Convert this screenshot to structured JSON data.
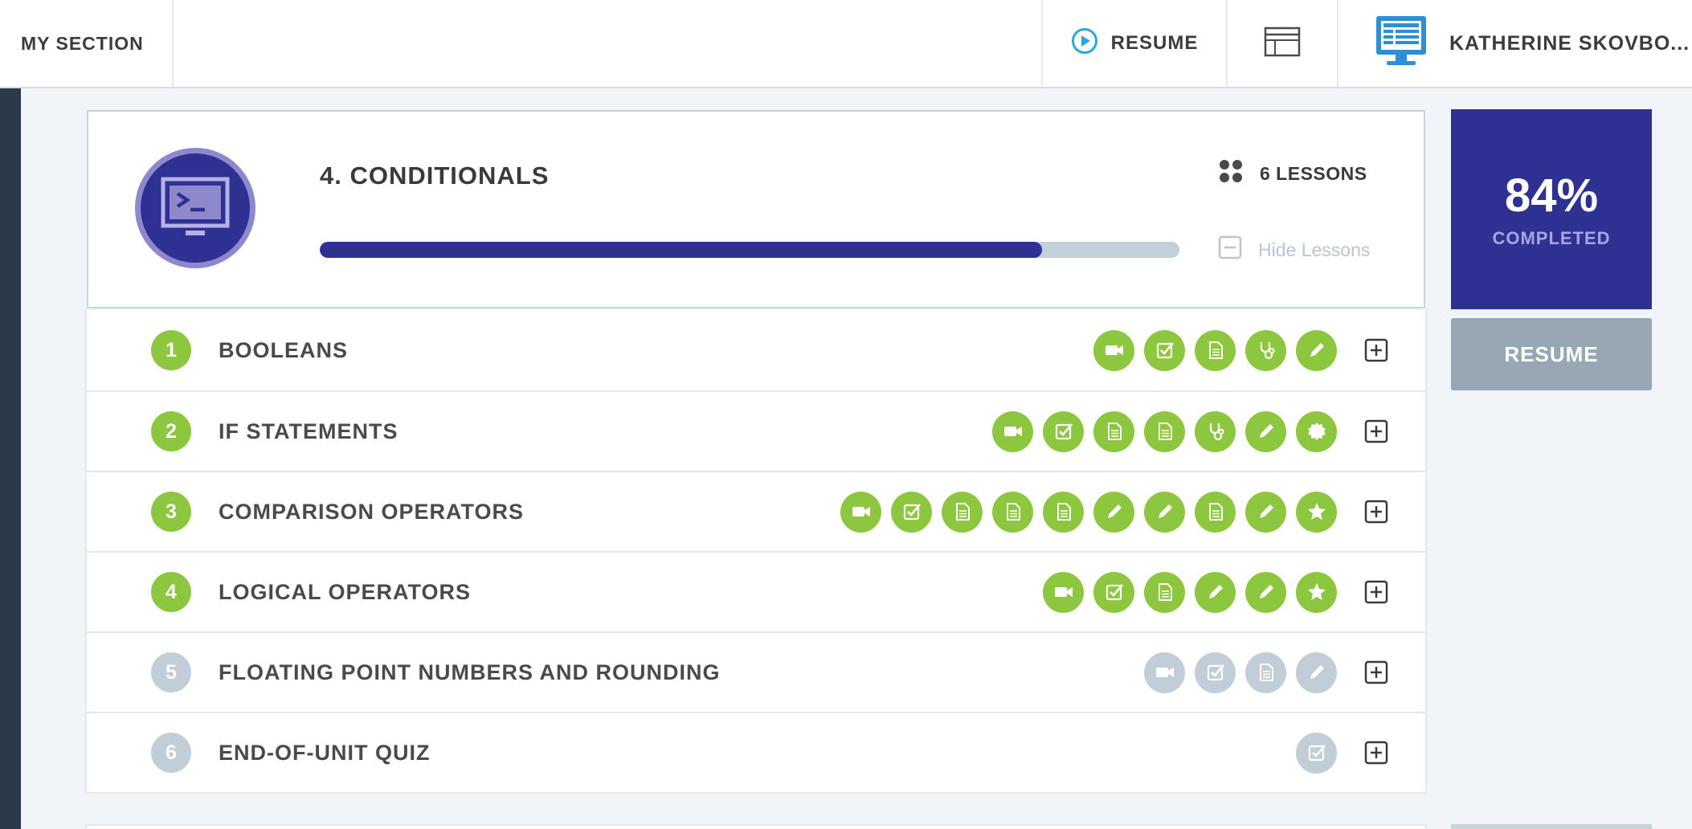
{
  "topbar": {
    "section_label": "MY SECTION",
    "resume_label": "RESUME",
    "user_name": "KATHERINE SKOVBO..."
  },
  "unit": {
    "title": "4. CONDITIONALS",
    "lessons_count": "6 LESSONS",
    "hide_lessons": "Hide Lessons",
    "progress_fraction": 0.84
  },
  "completion": {
    "percent": "84%",
    "label": "COMPLETED",
    "resume_button": "RESUME"
  },
  "colors": {
    "accent": "#2e3192",
    "complete_green": "#8dc63f",
    "pending_gray": "#c2ced7",
    "resume_gray": "#97a7b4"
  },
  "lessons": [
    {
      "number": "1",
      "title": "BOOLEANS",
      "status": "complete",
      "activities": [
        {
          "icon": "video-icon",
          "status": "complete"
        },
        {
          "icon": "checkbox-icon",
          "status": "complete"
        },
        {
          "icon": "document-icon",
          "status": "complete"
        },
        {
          "icon": "stethoscope-icon",
          "status": "complete"
        },
        {
          "icon": "pencil-icon",
          "status": "complete"
        }
      ]
    },
    {
      "number": "2",
      "title": "IF STATEMENTS",
      "status": "complete",
      "activities": [
        {
          "icon": "video-icon",
          "status": "complete"
        },
        {
          "icon": "checkbox-icon",
          "status": "complete"
        },
        {
          "icon": "document-icon",
          "status": "complete"
        },
        {
          "icon": "document-icon",
          "status": "complete"
        },
        {
          "icon": "stethoscope-icon",
          "status": "complete"
        },
        {
          "icon": "pencil-icon",
          "status": "complete"
        },
        {
          "icon": "badge-icon",
          "status": "complete"
        }
      ]
    },
    {
      "number": "3",
      "title": "COMPARISON OPERATORS",
      "status": "complete",
      "activities": [
        {
          "icon": "video-icon",
          "status": "complete"
        },
        {
          "icon": "checkbox-icon",
          "status": "complete"
        },
        {
          "icon": "document-icon",
          "status": "complete"
        },
        {
          "icon": "document-icon",
          "status": "complete"
        },
        {
          "icon": "document-icon",
          "status": "complete"
        },
        {
          "icon": "pencil-icon",
          "status": "complete"
        },
        {
          "icon": "pencil-icon",
          "status": "complete"
        },
        {
          "icon": "document-icon",
          "status": "complete"
        },
        {
          "icon": "pencil-icon",
          "status": "complete"
        },
        {
          "icon": "star-icon",
          "status": "complete"
        }
      ]
    },
    {
      "number": "4",
      "title": "LOGICAL OPERATORS",
      "status": "complete",
      "activities": [
        {
          "icon": "video-icon",
          "status": "complete"
        },
        {
          "icon": "checkbox-icon",
          "status": "complete"
        },
        {
          "icon": "document-icon",
          "status": "complete"
        },
        {
          "icon": "pencil-icon",
          "status": "complete"
        },
        {
          "icon": "pencil-icon",
          "status": "complete"
        },
        {
          "icon": "star-icon",
          "status": "complete"
        }
      ]
    },
    {
      "number": "5",
      "title": "FLOATING POINT NUMBERS AND ROUNDING",
      "status": "pending",
      "activities": [
        {
          "icon": "video-icon",
          "status": "pending"
        },
        {
          "icon": "checkbox-icon",
          "status": "pending"
        },
        {
          "icon": "document-icon",
          "status": "pending"
        },
        {
          "icon": "pencil-icon",
          "status": "pending"
        }
      ]
    },
    {
      "number": "6",
      "title": "END-OF-UNIT QUIZ",
      "status": "pending",
      "activities": [
        {
          "icon": "checkbox-icon",
          "status": "pending"
        }
      ]
    }
  ]
}
